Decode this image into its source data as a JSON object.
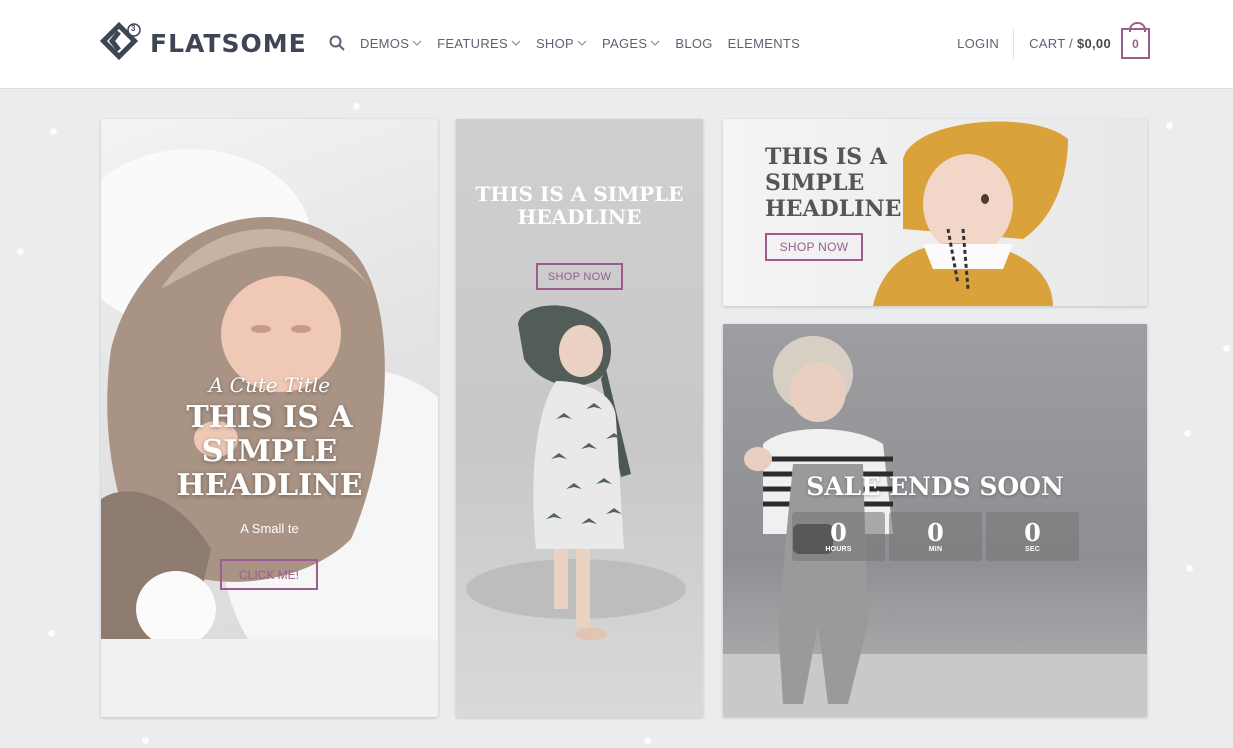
{
  "header": {
    "logo": {
      "text": "FLATSOME",
      "badge": "3"
    },
    "nav": [
      {
        "label": "DEMOS",
        "dropdown": true
      },
      {
        "label": "FEATURES",
        "dropdown": true
      },
      {
        "label": "SHOP",
        "dropdown": true
      },
      {
        "label": "PAGES",
        "dropdown": true
      },
      {
        "label": "BLOG",
        "dropdown": false
      },
      {
        "label": "ELEMENTS",
        "dropdown": false
      }
    ],
    "login": "LOGIN",
    "cart": {
      "label": "CART /",
      "amount": "$0,00",
      "count": "0"
    }
  },
  "banners": {
    "left": {
      "script_title": "A Cute Title",
      "headline": "THIS IS A SIMPLE HEADLINE",
      "small_text": "A Small te",
      "button": "CLICK ME!"
    },
    "middle": {
      "headline": "THIS IS A SIMPLE HEADLINE",
      "button": "SHOP NOW"
    },
    "top_right": {
      "headline": "THIS IS A SIMPLE HEADLINE",
      "button": "SHOP NOW"
    },
    "bottom_right": {
      "headline": "SALE ENDS SOON",
      "countdown": [
        {
          "value": "0",
          "label": "HOURS"
        },
        {
          "value": "0",
          "label": "MIN"
        },
        {
          "value": "0",
          "label": "SEC"
        }
      ]
    }
  },
  "colors": {
    "accent": "#9b5c8f",
    "text": "#5c6270",
    "logo": "#3e4656",
    "background": "#ebecee"
  }
}
